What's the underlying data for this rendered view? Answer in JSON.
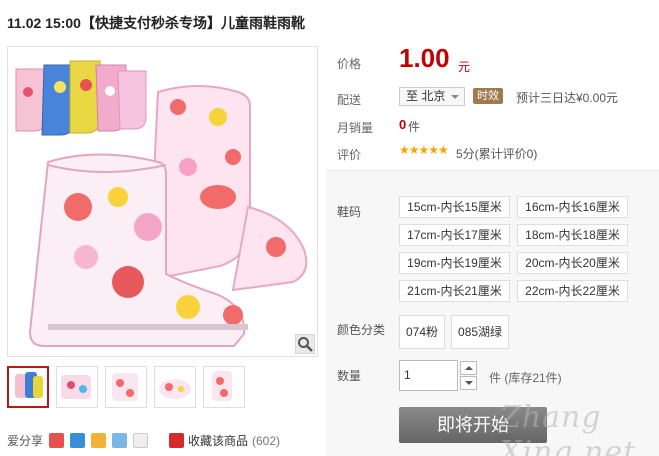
{
  "title": "11.02 15:00【快捷支付秒杀专场】儿童雨鞋雨靴",
  "price": {
    "label": "价格",
    "value": "1.00",
    "currency": "元"
  },
  "delivery": {
    "label": "配送",
    "destination": "至 北京",
    "badge": "时效",
    "estimate": "预计三日达¥0.00元"
  },
  "sales": {
    "label": "月销量",
    "count": "0",
    "unit": "件"
  },
  "review": {
    "label": "评价",
    "stars": "★★★★★",
    "text": "5分(累计评价0)"
  },
  "options": {
    "size_label": "鞋码",
    "sizes": [
      "15cm-内长15厘米",
      "16cm-内长16厘米",
      "17cm-内长17厘米",
      "18cm-内长18厘米",
      "19cm-内长19厘米",
      "20cm-内长20厘米",
      "21cm-内长21厘米",
      "22cm-内长22厘米"
    ],
    "color_label": "颜色分类",
    "colors": [
      "074粉",
      "085湖绿"
    ],
    "qty_label": "数量",
    "qty_value": "1",
    "stock_text": "件 (库存21件)",
    "buy_label": "即将开始"
  },
  "share": {
    "label": "爱分享",
    "favorite": "收藏该商品",
    "favorite_count": "(602)"
  },
  "watermark": "Zhang Xing.net",
  "accent_color": "#c40000"
}
